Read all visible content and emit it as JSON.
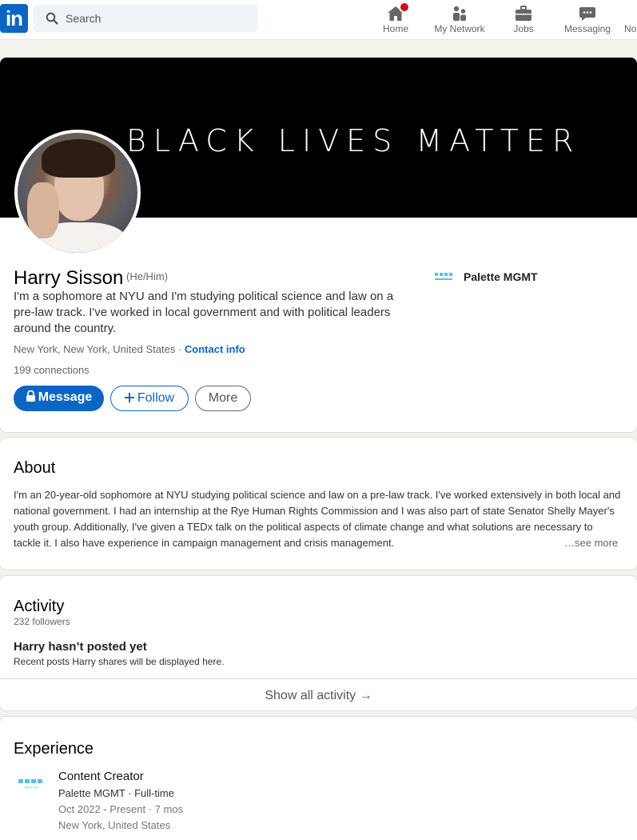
{
  "nav": {
    "logo": "in",
    "search_placeholder": "Search",
    "items": [
      {
        "label": "Home"
      },
      {
        "label": "My Network"
      },
      {
        "label": "Jobs"
      },
      {
        "label": "Messaging"
      },
      {
        "label": "No"
      }
    ]
  },
  "profile": {
    "banner_text": "BLACK LIVES MATTER",
    "name": "Harry Sisson",
    "pronouns": "(He/Him)",
    "headline": "I'm a sophomore at NYU and I'm studying political science and law on a pre-law track. I've worked in local government and with political leaders around the country.",
    "location": "New York, New York, United States",
    "location_sep": " · ",
    "contact_info": "Contact info",
    "connections": "199 connections",
    "message_label": "Message",
    "follow_label": "Follow",
    "more_label": "More",
    "company": "Palette MGMT"
  },
  "about": {
    "title": "About",
    "text": "I'm an 20-year-old sophomore at NYU studying political science and law on a pre-law track. I've worked extensively in both local and national government. I had an internship at the Rye Human Rights Commission and I was also part of state Senator Shelly Mayer's youth group. Additionally, I've given a TEDx talk on the political aspects of climate change and what solutions are necessary to tackle it. I also have experience in campaign management and crisis management.",
    "see_more": "…see more"
  },
  "activity": {
    "title": "Activity",
    "followers": "232 followers",
    "empty_title": "Harry hasn’t posted yet",
    "empty_sub": "Recent posts Harry shares will be displayed here.",
    "show_all": "Show all activity →"
  },
  "experience": {
    "title": "Experience",
    "logo_text": "PALETTE",
    "items": [
      {
        "title": "Content Creator",
        "company": "Palette MGMT · Full-time",
        "dates": "Oct 2022 - Present · 7 mos",
        "location": "New York, United States"
      }
    ]
  },
  "colors": {
    "brand": "#0a66c2",
    "badge": "#cc1016",
    "palette_logo": "#5bc0de"
  },
  "icons": [
    "search-icon",
    "home-icon",
    "network-icon",
    "jobs-icon",
    "messaging-icon",
    "lock-icon",
    "plus-icon",
    "arrow-right-icon"
  ]
}
